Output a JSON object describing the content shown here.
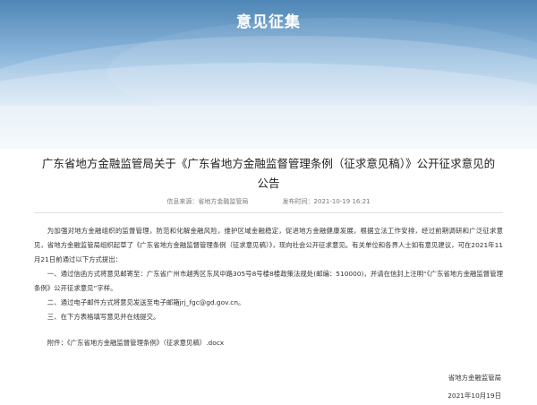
{
  "banner": {
    "title": "意见征集"
  },
  "notice": {
    "title_line1": "广东省地方金融监管局关于《广东省地方金融监督管理条例（征求意见稿）》公开征求意见的",
    "title_line2": "公告",
    "source": "信息来源：省地方金融监管局",
    "publish_time": "发布时间：2021-10-19 16:21"
  },
  "body": {
    "intro": "为加强对地方金融组织的监督管理，防范和化解金融风险，维护区域金融稳定，促进地方金融健康发展，根据立法工作安排，经过前期调研和广泛征求意见，省地方金融监管局组织起草了《广东省地方金融监督管理条例（征求意见稿）》，现向社会公开征求意见。有关单位和各界人士如有意见建议，可在2021年11月21日前通过以下方式提出：",
    "item1": "一、通过信函方式将意见邮寄至：广东省广州市越秀区东风中路305号8号楼8楼政策法规处(邮编：510000)，并请在信封上注明“《广东省地方金融监督管理条例》公开征求意见”字样。",
    "item2": "二、通过电子邮件方式将意见发送至电子邮箱jrj_fgc@gd.gov.cn。",
    "item3": "三、在下方表格填写意见并在线提交。"
  },
  "attachment": {
    "text": "附件：《广东省地方金融监督管理条例》（征求意见稿）.docx"
  },
  "signature": {
    "org": "省地方金融监管局",
    "date": "2021年10月19日"
  }
}
